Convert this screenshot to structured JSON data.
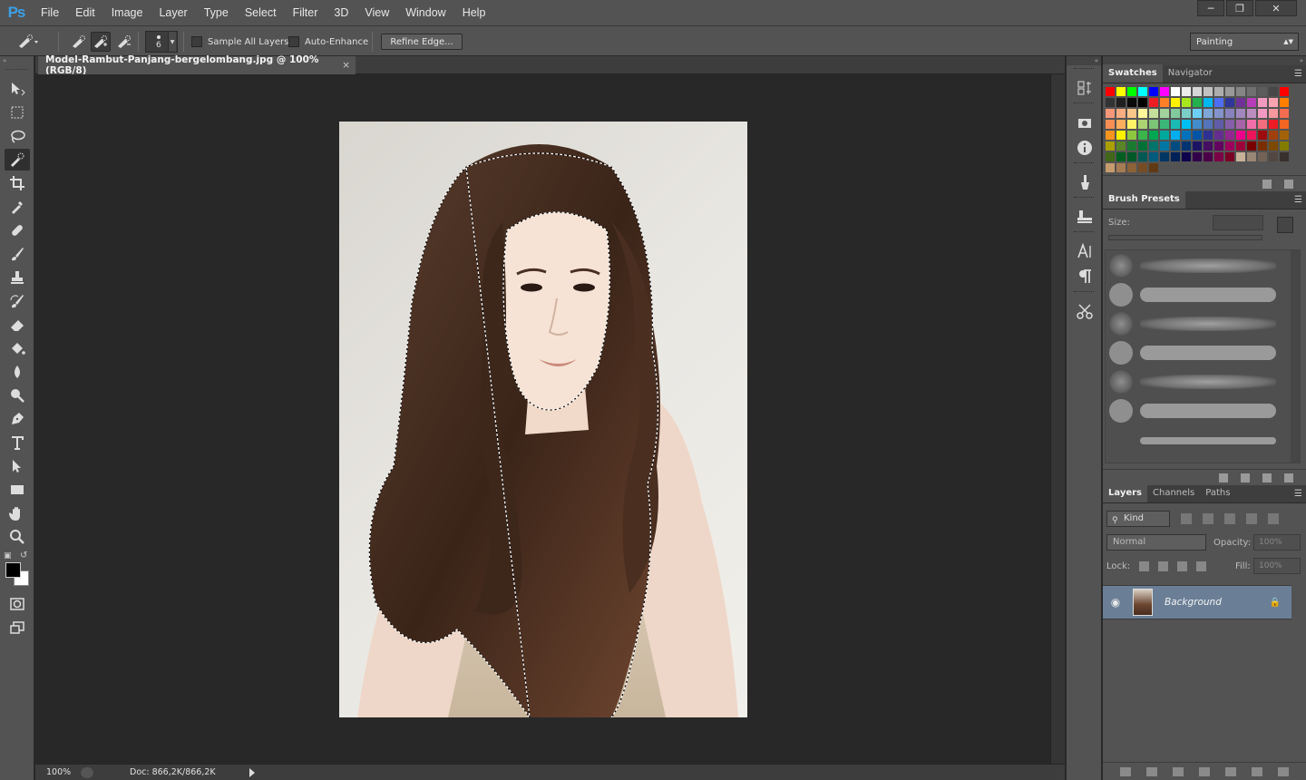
{
  "menubar": {
    "logo": "Ps",
    "items": [
      "File",
      "Edit",
      "Image",
      "Layer",
      "Type",
      "Select",
      "Filter",
      "3D",
      "View",
      "Window",
      "Help"
    ]
  },
  "options": {
    "brush_size": "6",
    "sample_all_layers": "Sample All Layers",
    "auto_enhance": "Auto-Enhance",
    "refine_edge": "Refine Edge...",
    "workspace": "Painting"
  },
  "document": {
    "tab_title": "Model-Rambut-Panjang-bergelombang.jpg @ 100% (RGB/8)",
    "tab_close": "×",
    "zoom": "100%",
    "doc_size": "Doc: 866,2K/866,2K"
  },
  "panels": {
    "swatch_tabs": [
      "Swatches",
      "Navigator"
    ],
    "brush_presets_tab": "Brush Presets",
    "size_label": "Size:",
    "layer_tabs": [
      "Layers",
      "Channels",
      "Paths"
    ],
    "kind_label": "Kind",
    "blend_mode": "Normal",
    "opacity_label": "Opacity:",
    "opacity_value": "100%",
    "lock_label": "Lock:",
    "fill_label": "Fill:",
    "fill_value": "100%",
    "layer_name": "Background"
  },
  "colors": {
    "swatches": [
      "#ff0000",
      "#ffff00",
      "#00ff00",
      "#00ffff",
      "#0000ff",
      "#ff00ff",
      "#ffffff",
      "#ebebeb",
      "#d6d6d6",
      "#c2c2c2",
      "#adadad",
      "#999999",
      "#858585",
      "#707070",
      "#5c5c5c",
      "#474747",
      "#ff0000",
      "#333333",
      "#1f1f1f",
      "#0a0a0a",
      "#000000",
      "#ee1d24",
      "#ff7f27",
      "#fff200",
      "#a8e61d",
      "#22b14c",
      "#00b7ef",
      "#4d6df3",
      "#2f3699",
      "#6f3198",
      "#b83dba",
      "#f49ac1",
      "#ffa3b1",
      "#ff7e00",
      "#f7977a",
      "#f9ad81",
      "#fdc68a",
      "#fff79a",
      "#c4df9b",
      "#a3d39c",
      "#82ca9d",
      "#7bcdc8",
      "#6ecff6",
      "#7ea7d8",
      "#8493ca",
      "#8882be",
      "#a187be",
      "#bc8dbf",
      "#f49ac2",
      "#f6989d",
      "#f26c4f",
      "#f68e55",
      "#fbaf5c",
      "#fff467",
      "#acd372",
      "#7cc576",
      "#3bb878",
      "#1abbb4",
      "#00bff3",
      "#438ccb",
      "#5574b9",
      "#605ca8",
      "#855fa8",
      "#a763a8",
      "#f06ea9",
      "#f26d7d",
      "#ed1c24",
      "#f26522",
      "#f7941d",
      "#fff200",
      "#8dc73f",
      "#39b54a",
      "#00a651",
      "#00a99d",
      "#00aeef",
      "#0072bc",
      "#0054a6",
      "#2e3192",
      "#662d91",
      "#92278f",
      "#ec008c",
      "#ed145b",
      "#9e0b0f",
      "#a0410d",
      "#a36209",
      "#aba000",
      "#598527",
      "#1a7b30",
      "#007236",
      "#00746b",
      "#0076a3",
      "#004b80",
      "#003471",
      "#1b1464",
      "#440e62",
      "#630460",
      "#9e005d",
      "#9e0039",
      "#790000",
      "#7b2e00",
      "#7d4900",
      "#827b00",
      "#406618",
      "#005e20",
      "#005826",
      "#005952",
      "#005b7f",
      "#003663",
      "#002157",
      "#0d004c",
      "#32004b",
      "#4b0049",
      "#7b0046",
      "#7a0026",
      "#c7b299",
      "#998675",
      "#736357",
      "#534741",
      "#37302d",
      "#c69c6d",
      "#a67c52",
      "#8c6239",
      "#754c24",
      "#603913"
    ]
  }
}
